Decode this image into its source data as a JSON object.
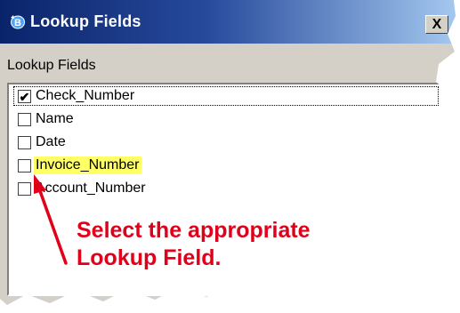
{
  "window": {
    "title": "Lookup Fields",
    "close_label": "X"
  },
  "group": {
    "label": "Lookup Fields"
  },
  "fields": [
    {
      "label": "Check_Number",
      "checked": true,
      "highlighted": false
    },
    {
      "label": "Name",
      "checked": false,
      "highlighted": false
    },
    {
      "label": "Date",
      "checked": false,
      "highlighted": false
    },
    {
      "label": "Invoice_Number",
      "checked": false,
      "highlighted": true
    },
    {
      "label": "Account_Number",
      "checked": false,
      "highlighted": false
    }
  ],
  "annotation": {
    "line1": "Select the appropriate",
    "line2": "Lookup Field."
  },
  "colors": {
    "annotation": "#e0001a",
    "highlight": "#ffff66",
    "titlebar_start": "#0a246a",
    "titlebar_end": "#a6caf0"
  }
}
